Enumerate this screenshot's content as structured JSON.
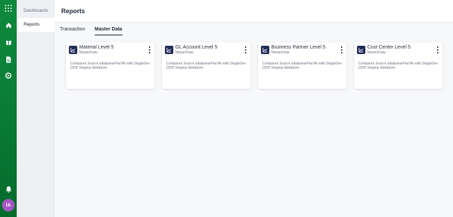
{
  "rail": {
    "icons": [
      "apps-grid-icon",
      "home-icon",
      "book-icon",
      "document-icon",
      "gear-icon",
      "bell-icon"
    ],
    "avatar_initials": "IA",
    "brand_color": "#0a7a36"
  },
  "subnav": {
    "items": [
      {
        "label": "Dashboards",
        "active": false
      },
      {
        "label": "Reports",
        "active": true
      }
    ]
  },
  "header": {
    "title": "Reports"
  },
  "tabs": [
    {
      "label": "Transaction",
      "active": false
    },
    {
      "label": "Master Data",
      "active": true
    }
  ],
  "cards": [
    {
      "title": "Material Level 5",
      "subtitle": "MasterData",
      "description": "Compares Source database/Flat file with StageOne (ISW Staging database)",
      "icon": "line-chart-icon"
    },
    {
      "title": "GL Account Level 5",
      "subtitle": "MasterData",
      "description": "Compares Source database/Flat file with StageOne (ISW Staging database)",
      "icon": "line-chart-icon"
    },
    {
      "title": "Business Partner Level 5",
      "subtitle": "MasterData",
      "description": "Compares Source database/Flat file with StageOne (ISW Staging database)",
      "icon": "line-chart-icon"
    },
    {
      "title": "Cost Center Level 5",
      "subtitle": "MasterData",
      "description": "Compares Source database/Flat file with StageOne (ISW Staging database)",
      "icon": "line-chart-icon"
    }
  ]
}
